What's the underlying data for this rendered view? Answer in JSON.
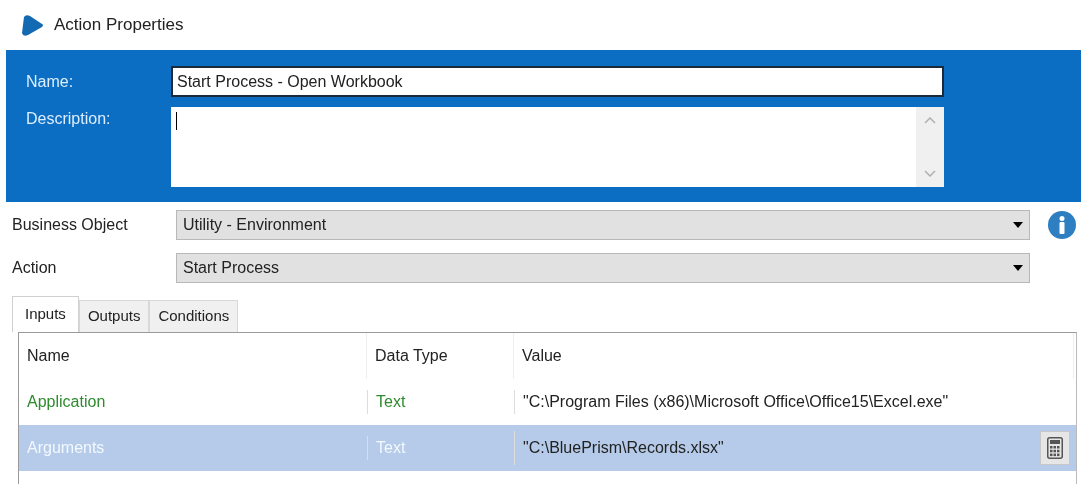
{
  "window": {
    "title": "Action Properties"
  },
  "header": {
    "name_label": "Name:",
    "name_value": "Start Process - Open Workbook",
    "description_label": "Description:"
  },
  "business_object": {
    "label": "Business Object",
    "value": "Utility - Environment"
  },
  "action": {
    "label": "Action",
    "value": "Start Process"
  },
  "tabs": [
    {
      "label": "Inputs",
      "selected": true
    },
    {
      "label": "Outputs",
      "selected": false
    },
    {
      "label": "Conditions",
      "selected": false
    }
  ],
  "table": {
    "columns": [
      "Name",
      "Data Type",
      "Value"
    ],
    "rows": [
      {
        "name": "Application",
        "data_type": "Text",
        "value": "\"C:\\Program Files (x86)\\Microsoft Office\\Office15\\Excel.exe\"",
        "selected": false
      },
      {
        "name": "Arguments",
        "data_type": "Text",
        "value": "\"C:\\BluePrism\\Records.xlsx\"",
        "selected": true
      }
    ]
  }
}
